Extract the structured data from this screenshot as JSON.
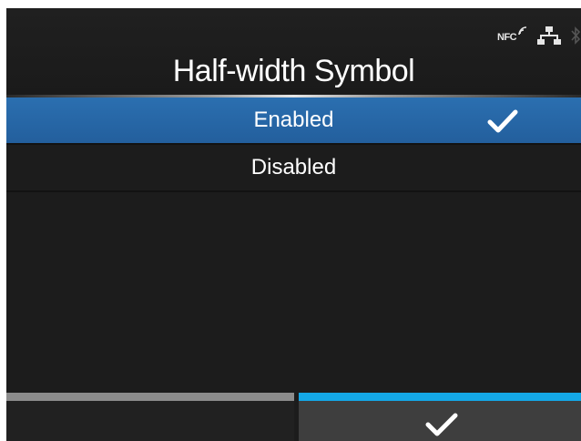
{
  "screen": {
    "title": "Half-width Symbol",
    "status_icons": [
      "nfc-icon",
      "network-icon",
      "bluetooth-icon"
    ],
    "nfc_label": "NFC"
  },
  "options": [
    {
      "label": "Enabled",
      "selected": true,
      "checked": true
    },
    {
      "label": "Disabled",
      "selected": false,
      "checked": false
    }
  ],
  "softkeys": {
    "left": {
      "label": ""
    },
    "right": {
      "icon": "checkmark-icon"
    }
  },
  "colors": {
    "selection": "#2b6fb0",
    "confirm_bar": "#14a7e6",
    "back_bar": "#8c8c8c"
  }
}
